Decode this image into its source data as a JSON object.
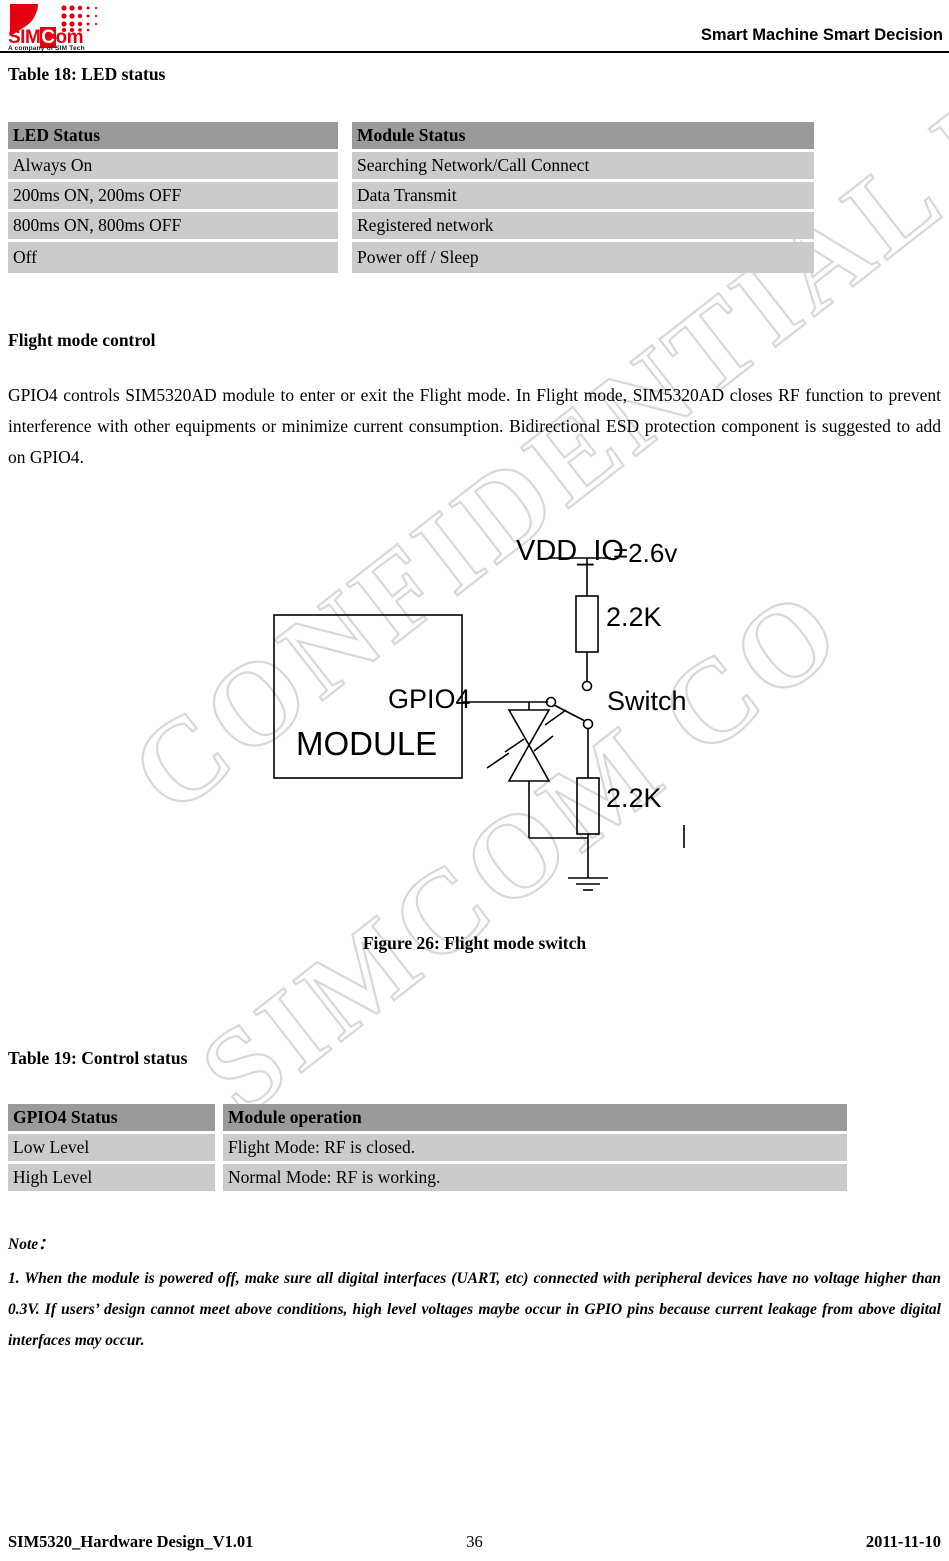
{
  "header": {
    "logo_word_sim": "SIM",
    "logo_word_c": "C",
    "logo_word_om": "om",
    "logo_tagline": "A company of SIM Tech",
    "slogan": "Smart Machine Smart Decision"
  },
  "watermark": {
    "line1": "CONFIDENTIAL FILE",
    "line2": "SIMCOM CO"
  },
  "table18": {
    "caption": "Table 18: LED status",
    "columns": [
      "LED Status",
      "Module Status"
    ],
    "rows": [
      [
        "Always On",
        "Searching Network/Call Connect"
      ],
      [
        "200ms ON, 200ms OFF",
        "Data Transmit"
      ],
      [
        "800ms ON, 800ms OFF",
        "Registered network"
      ],
      [
        "Off",
        "Power off / Sleep"
      ]
    ]
  },
  "flight_section": {
    "heading": "Flight mode control",
    "paragraph": "GPIO4 controls SIM5320AD module to enter or exit the Flight mode. In Flight mode, SIM5320AD closes RF function to prevent interference with other equipments or minimize current consumption. Bidirectional ESD protection component is suggested to add on GPIO4."
  },
  "figure26": {
    "caption": "Figure 26: Flight mode switch",
    "labels": {
      "vdd": "VDD_IO",
      "vdd_value": "=2.6v",
      "resistor_top": "2.2K",
      "resistor_bottom": "2.2K",
      "switch": "Switch",
      "gpio": "GPIO4",
      "module": "MODULE"
    }
  },
  "table19": {
    "caption": "Table 19: Control status",
    "columns": [
      "GPIO4 Status",
      "Module operation"
    ],
    "rows": [
      [
        "Low Level",
        "Flight Mode: RF is closed."
      ],
      [
        "High Level",
        "Normal Mode: RF is working."
      ]
    ]
  },
  "note": {
    "label": "Note：",
    "body": "1. When the module is powered off, make sure all digital interfaces (UART, etc) connected with peripheral devices have no voltage higher than 0.3V. If users’ design cannot meet above conditions, high level voltages maybe occur in GPIO pins because current leakage from above digital interfaces may occur."
  },
  "footer": {
    "doc": "SIM5320_Hardware Design_V1.01",
    "page": "36",
    "date": "2011-11-10"
  },
  "colors": {
    "brand_red": "#e3000f",
    "table_header": "#9a9a9a",
    "table_body": "#cbcbcb",
    "watermark": "#d8d8d8"
  }
}
